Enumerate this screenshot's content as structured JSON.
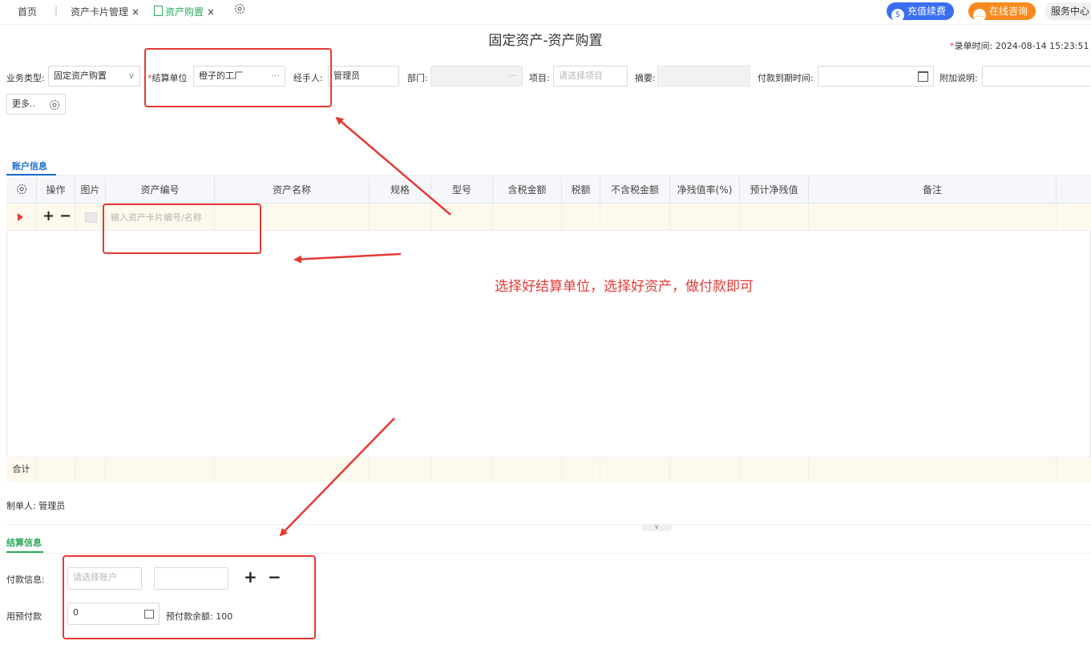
{
  "tabs": [
    {
      "label": "首页"
    },
    {
      "label": "资产卡片管理"
    },
    {
      "label": "资产购置",
      "active": true
    }
  ],
  "tab_close": "×",
  "header_buttons": {
    "recharge": "充值续费",
    "consult": "在线咨询",
    "service": "服务中心"
  },
  "page_title": "固定资产-资产购置",
  "record_time": {
    "label": "录单时间:",
    "value": "2024-08-14 15:23:51"
  },
  "form": {
    "biz_type": {
      "label": "业务类型:",
      "value": "固定资产购置"
    },
    "settle_unit": {
      "label": "结算单位",
      "value": "橙子的工厂"
    },
    "handler": {
      "label": "经手人:",
      "value": "管理员"
    },
    "dept": {
      "label": "部门:",
      "value": ""
    },
    "project": {
      "label": "项目:",
      "placeholder": "请选择项目"
    },
    "summary": {
      "label": "摘要:",
      "value": ""
    },
    "due_time": {
      "label": "付款到期时间:",
      "value": ""
    },
    "extra_note": {
      "label": "附加说明:",
      "value": ""
    },
    "more_button": "更多.."
  },
  "section_tab": "账户信息",
  "table": {
    "columns": [
      "操作",
      "图片",
      "资产编号",
      "资产名称",
      "规格",
      "型号",
      "含税金额",
      "税额",
      "不含税金额",
      "净残值率(%)",
      "预计净残值",
      "备注"
    ],
    "row_placeholder": "输入资产卡片编号/名称",
    "total_label": "合计"
  },
  "creator": {
    "label": "制单人:",
    "value": "管理员"
  },
  "settle_tab": "结算信息",
  "payment": {
    "label": "付款信息:",
    "account_placeholder": "请选择账户",
    "amount": ""
  },
  "prepay": {
    "label": "用预付款",
    "value": "0",
    "balance_label": "预付款余额:",
    "balance_value": "100"
  },
  "annotation": "选择好结算单位，选择好资产，做付款即可",
  "colors": {
    "accent_green": "#2bab5a",
    "link_blue": "#1a6fd1",
    "annotation_red": "#e53935",
    "recharge_blue": "#3a6ff0",
    "consult_orange": "#f7891e"
  }
}
